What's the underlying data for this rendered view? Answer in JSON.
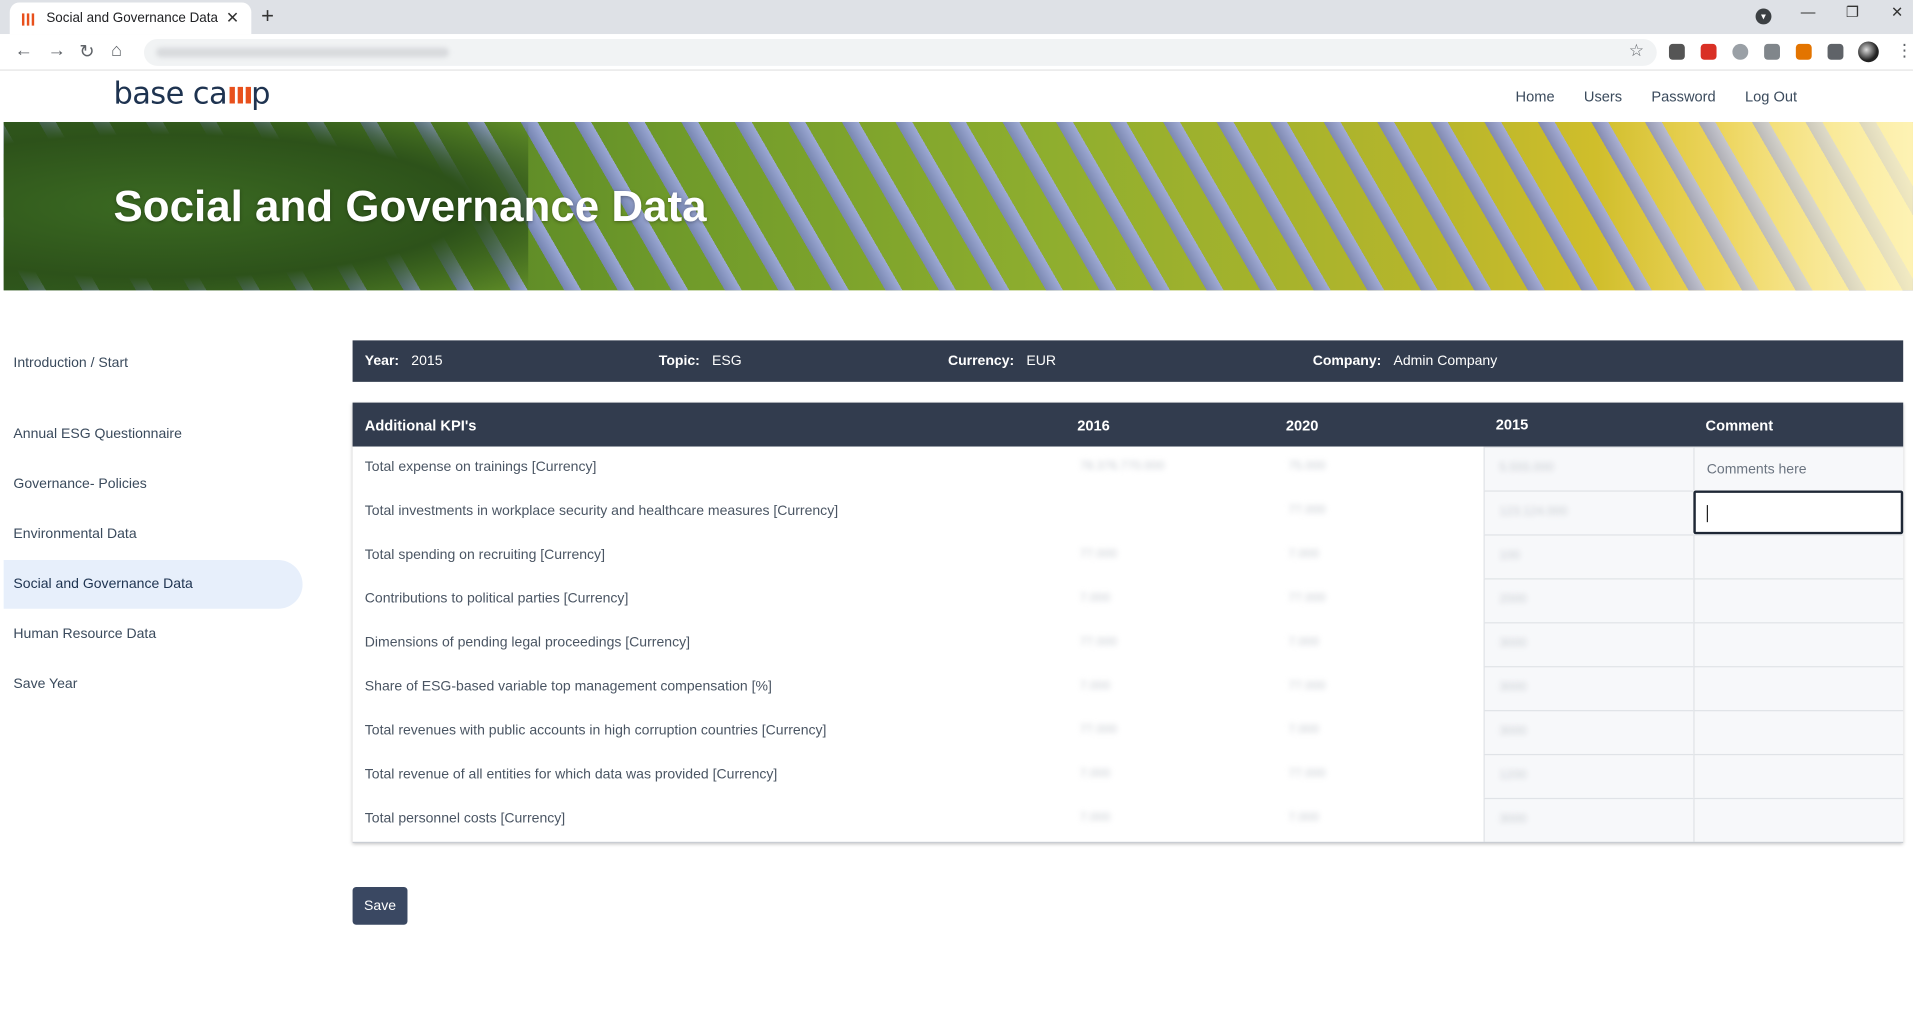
{
  "browser": {
    "tab_title": "Social and Governance Data",
    "tab_close": "✕",
    "new_tab": "+",
    "minimize": "—",
    "restore": "❐",
    "close": "✕"
  },
  "app": {
    "logo_text_a": "base ca",
    "logo_bars": "ııı",
    "logo_text_b": "p",
    "nav": [
      "Home",
      "Users",
      "Password",
      "Log Out"
    ],
    "hero_title": "Social and Governance Data"
  },
  "sidebar": {
    "items": [
      {
        "label": "Introduction / Start",
        "active": false
      },
      {
        "label": "Annual ESG Questionnaire",
        "active": false
      },
      {
        "label": "Governance- Policies",
        "active": false
      },
      {
        "label": "Environmental Data",
        "active": false
      },
      {
        "label": "Social and Governance Data",
        "active": true
      },
      {
        "label": "Human Resource Data",
        "active": false
      },
      {
        "label": "Save Year",
        "active": false
      }
    ]
  },
  "info": {
    "year_label": "Year:",
    "year_value": "2015",
    "topic_label": "Topic:",
    "topic_value": "ESG",
    "currency_label": "Currency:",
    "currency_value": "EUR",
    "company_label": "Company:",
    "company_value": "Admin Company"
  },
  "table": {
    "headers": [
      "Additional KPI's",
      "2016",
      "2020",
      "2015",
      "Comment"
    ],
    "comment_placeholder": "Comments here",
    "rows": [
      {
        "kpi": "Total expense on trainings [Currency]",
        "v2016": "78.376.770.000",
        "v2020": "75.000",
        "v2015": "5.555.000"
      },
      {
        "kpi": "Total investments in workplace security and healthcare measures [Currency]",
        "v2016": "",
        "v2020": "77.000",
        "v2015": "123.124.000"
      },
      {
        "kpi": "Total spending on recruiting [Currency]",
        "v2016": "77.000",
        "v2020": "7.000",
        "v2015": "100"
      },
      {
        "kpi": "Contributions to political parties [Currency]",
        "v2016": "7.000",
        "v2020": "77.000",
        "v2015": "2000"
      },
      {
        "kpi": "Dimensions of pending legal proceedings [Currency]",
        "v2016": "77.000",
        "v2020": "7.000",
        "v2015": "3000"
      },
      {
        "kpi": "Share of ESG-based variable top management compensation [%]",
        "v2016": "7.000",
        "v2020": "77.000",
        "v2015": "3000"
      },
      {
        "kpi": "Total revenues with public accounts in high corruption countries [Currency]",
        "v2016": "77.000",
        "v2020": "7.000",
        "v2015": "3000"
      },
      {
        "kpi": "Total revenue of all entities for which data was provided [Currency]",
        "v2016": "7.000",
        "v2020": "77.000",
        "v2015": "1200"
      },
      {
        "kpi": "Total personnel costs [Currency]",
        "v2016": "7.000",
        "v2020": "7.000",
        "v2015": "3000"
      }
    ]
  },
  "actions": {
    "save_label": "Save"
  },
  "colors": {
    "header_bg": "#323c4e",
    "accent": "#e8501c",
    "active_nav": "#e7effb"
  }
}
